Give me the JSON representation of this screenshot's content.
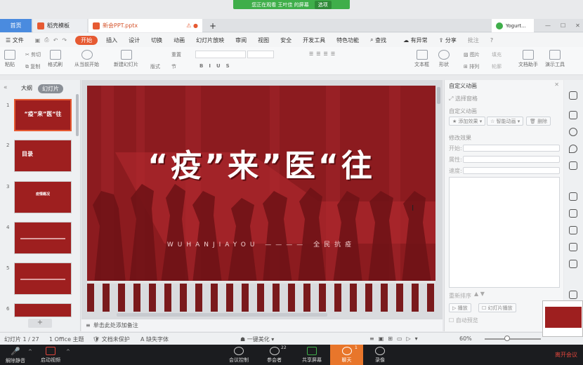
{
  "share_banner": {
    "text": "您正在观看 王叶佳 的屏幕",
    "option": "选项"
  },
  "tabs": {
    "home": "首页",
    "template": "稻壳模板",
    "document": "新会PPT.pptx",
    "account": "Yogurt..."
  },
  "menu": {
    "file": "文件",
    "items": [
      "开始",
      "插入",
      "设计",
      "切换",
      "动画",
      "幻灯片放映",
      "审阅",
      "视图",
      "安全",
      "开发工具",
      "特色功能"
    ],
    "search": "查找",
    "issues": "有异常",
    "share": "分享",
    "annotate": "批注"
  },
  "ribbon": {
    "paste": "粘贴",
    "cut": "剪切",
    "copy": "复制",
    "format_painter": "格式刷",
    "from_current": "从当前开始",
    "new_slide": "新建幻灯片",
    "layout": "版式",
    "section": "节",
    "reset": "重置",
    "textbox": "文本框",
    "shape": "形状",
    "picture": "图片",
    "arrange": "排列",
    "fill": "填充",
    "outline": "轮廓",
    "doc_helper": "文档助手",
    "present_tools": "演示工具"
  },
  "left_panel": {
    "tab_outline": "大纲",
    "tab_slides": "幻灯片",
    "thumbs": [
      {
        "num": "1",
        "title": "“疫”来”医“往"
      },
      {
        "num": "2",
        "title": "目录"
      },
      {
        "num": "3",
        "title": "疫情概况"
      },
      {
        "num": "4",
        "title": ""
      },
      {
        "num": "5",
        "title": ""
      },
      {
        "num": "6",
        "title": ""
      }
    ]
  },
  "slide": {
    "title": "“疫”来”医“往",
    "subtitle": "WUHANJIAYOU ———— 全民抗疫"
  },
  "notes_placeholder": "单击此处添加备注",
  "right_panel": {
    "header": "自定义动画",
    "select_pane": "选择窗格",
    "section_custom": "自定义动画",
    "add_effect": "添加效果",
    "smart_anim": "智能动画",
    "delete": "删除",
    "modify": "修改效果",
    "start": "开始:",
    "property": "属性:",
    "speed": "速度:",
    "reorder": "重新排序",
    "play": "播放",
    "slideshow": "幻灯片播放",
    "autopreview": "自动预览"
  },
  "status": {
    "slide_info": "幻灯片 1 / 27",
    "theme": "1 Office 主题",
    "doc_unprotected": "文档未保护",
    "missing_font": "缺失字体",
    "beautify": "一键美化",
    "zoom": "60%"
  },
  "meeting": {
    "unmute": "解除静音",
    "video": "启动视频",
    "meeting_control": "会议控制",
    "participants": "参会者",
    "participants_count": "22",
    "share_screen": "共享屏幕",
    "chat": "聊天",
    "chat_count": "1",
    "record": "录像",
    "leave": "离开会议"
  },
  "colors": {
    "accent": "#e65a32",
    "slide_red": "#8c1b1f",
    "meeting_bg": "#1b1c1f",
    "chat": "#e8762b"
  }
}
